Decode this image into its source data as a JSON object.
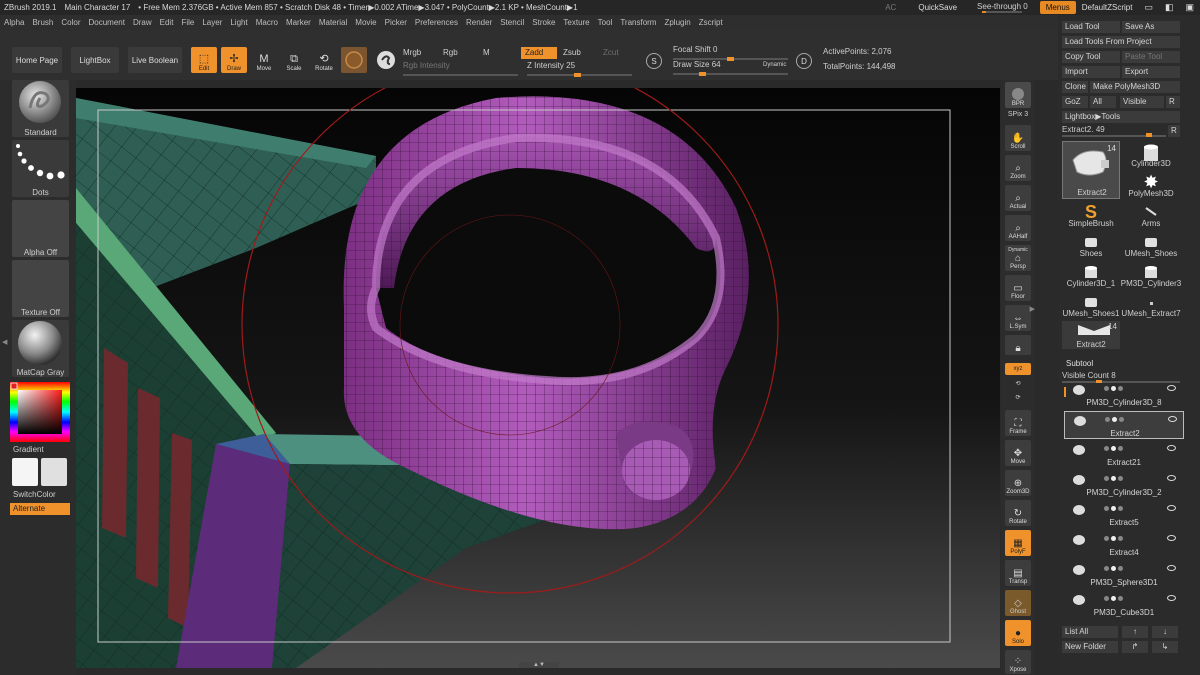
{
  "titlebar": {
    "app": "ZBrush 2019.1",
    "doc": "Main Character 17",
    "mem": "• Free Mem 2.376GB • Active Mem 857 • Scratch Disk 48 • Timer▶0.002 ATime▶3.047 • PolyCount▶2.1 KP • MeshCount▶1",
    "ac": "AC",
    "quicksave": "QuickSave",
    "seethrough": "See-through",
    "seethrough_value": "0",
    "menus": "Menus",
    "script": "DefaultZScript"
  },
  "menubar": [
    "Alpha",
    "Brush",
    "Color",
    "Document",
    "Draw",
    "Edit",
    "File",
    "Layer",
    "Light",
    "Macro",
    "Marker",
    "Material",
    "Movie",
    "Picker",
    "Preferences",
    "Render",
    "Stencil",
    "Stroke",
    "Texture",
    "Tool",
    "Transform",
    "Zplugin",
    "Zscript"
  ],
  "toolbar": {
    "home": "Home Page",
    "lightbox": "LightBox",
    "liveboolean": "Live Boolean",
    "edit": "Edit",
    "draw": "Draw",
    "move": "Move",
    "scale": "Scale",
    "rotate": "Rotate",
    "mrgb": "Mrgb",
    "rgb": "Rgb",
    "m": "M",
    "rgb_intensity": "Rgb Intensity",
    "zadd": "Zadd",
    "zsub": "Zsub",
    "zcut": "Zcut",
    "z_intensity_label": "Z Intensity",
    "z_intensity": "25",
    "focal_label": "Focal Shift",
    "focal": "0",
    "drawsize_label": "Draw Size",
    "drawsize": "64",
    "dynamic": "Dynamic",
    "active_points": "ActivePoints: 2,076",
    "total_points": "TotalPoints: 144,498",
    "s_label": "S",
    "d_label": "D"
  },
  "leftshelf": {
    "brush": "Standard",
    "stroke": "Dots",
    "alpha": "Alpha Off",
    "texture": "Texture Off",
    "material": "MatCap Gray",
    "gradient": "Gradient",
    "switchcolor": "SwitchColor",
    "alternate": "Alternate"
  },
  "rightshelf": {
    "bpr": "BPR",
    "spix": "SPix 3",
    "scroll": "Scroll",
    "zoom": "Zoom",
    "actual": "Actual",
    "aahalf": "AAHalf",
    "dynamic": "Dynamic",
    "persp": "Persp",
    "floor": "Floor",
    "lsym": "L.Sym",
    "xyz": "xyz",
    "frame": "Frame",
    "move": "Move",
    "zoom3d": "Zoom3D",
    "rotate": "Rotate",
    "polyf": "PolyF",
    "transp": "Transp",
    "ghost": "Ghost",
    "solo": "Solo",
    "xpose": "Xpose"
  },
  "tray": {
    "load_tool": "Load Tool",
    "save_as": "Save As",
    "load_from_project": "Load Tools From Project",
    "copy_tool": "Copy Tool",
    "paste_tool": "Paste Tool",
    "import": "Import",
    "export": "Export",
    "clone": "Clone",
    "make_polymesh": "Make PolyMesh3D",
    "goz": "GoZ",
    "all": "All",
    "visible": "Visible",
    "r": "R",
    "lightbox_tools": "Lightbox▶Tools",
    "current_tool": "Extract2.",
    "current_value": "49",
    "tools": [
      {
        "name": "Extract2",
        "badge": "14"
      },
      {
        "name": "Cylinder3D"
      },
      {
        "name": "PolyMesh3D"
      },
      {
        "name": "SimpleBrush"
      },
      {
        "name": "Arms"
      },
      {
        "name": "Shoes"
      },
      {
        "name": "UMesh_Shoes"
      },
      {
        "name": "Cylinder3D_1"
      },
      {
        "name": "PM3D_Cylinder3"
      },
      {
        "name": "UMesh_Shoes1"
      },
      {
        "name": "UMesh_Extract7"
      },
      {
        "name": "Extract2",
        "badge": "14"
      }
    ],
    "subtool_title": "Subtool",
    "visible_count": "Visible Count 8",
    "subtools": [
      "PM3D_Cylinder3D_8",
      "Extract2",
      "Extract21",
      "PM3D_Cylinder3D_2",
      "Extract5",
      "Extract4",
      "PM3D_Sphere3D1",
      "PM3D_Cube3D1"
    ],
    "list_all": "List All",
    "new_folder": "New Folder"
  },
  "colors": {
    "accent": "#f0922b",
    "mesh_magenta": "#a64bb0",
    "mesh_teal": "#2f6b5c",
    "mesh_green": "#4f9a6a",
    "mesh_purple": "#5e2c7a",
    "brush_ring": "#b0201f"
  }
}
